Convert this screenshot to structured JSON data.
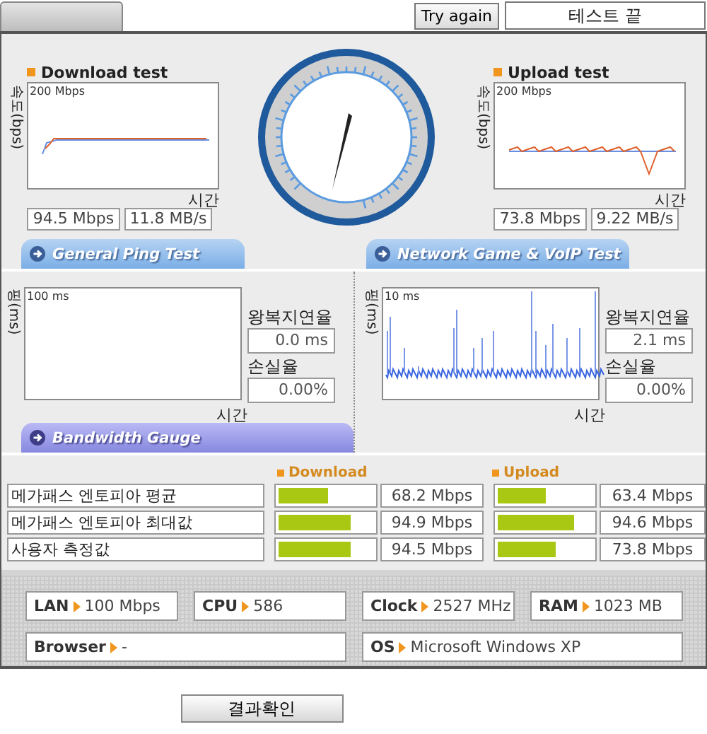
{
  "top_bar": {
    "button": "Try again",
    "status": "테스트 끝"
  },
  "speed_tests": [
    {
      "title": "Download test",
      "ylabel": "속도(bps)",
      "scale": "200 Mbps",
      "xlabel": "시간",
      "readings": [
        "94.5 Mbps",
        "11.8 MB/s"
      ]
    },
    {
      "title": "Upload test",
      "ylabel": "속도(bps)",
      "scale": "200 Mbps",
      "xlabel": "시간",
      "readings": [
        "73.8 Mbps",
        "9.22 MB/s"
      ]
    }
  ],
  "section_tabs": [
    "General Ping Test",
    "Network Game & VoIP Test"
  ],
  "ping_tests": [
    {
      "ylabel": "핑(ms)",
      "scale": "100 ms",
      "xlabel": "시간",
      "has_trace": false,
      "latency_label": "왕복지연율",
      "latency": "0.0 ms",
      "loss_label": "손실율",
      "loss": "0.00%"
    },
    {
      "ylabel": "핑(ms)",
      "scale": "10 ms",
      "xlabel": "시간",
      "has_trace": true,
      "latency_label": "왕복지연율",
      "latency": "2.1 ms",
      "loss_label": "손실율",
      "loss": "0.00%"
    }
  ],
  "bandwidth_tab": "Bandwidth Gauge",
  "comparison": {
    "columns": [
      "Download",
      "Upload"
    ],
    "rows": [
      {
        "label": "메가패스 엔토피아 평균",
        "download": {
          "level": 0.55,
          "reading": "68.2 Mbps"
        },
        "upload": {
          "level": 0.54,
          "reading": "63.4 Mbps"
        }
      },
      {
        "label": "메가패스 엔토피아 최대값",
        "download": {
          "level": 0.78,
          "reading": "94.9 Mbps"
        },
        "upload": {
          "level": 0.82,
          "reading": "94.6 Mbps"
        }
      },
      {
        "label": "사용자 측정값",
        "download": {
          "level": 0.77,
          "reading": "94.5 Mbps"
        },
        "upload": {
          "level": 0.63,
          "reading": "73.8 Mbps"
        }
      }
    ]
  },
  "system_info": [
    {
      "label": "LAN",
      "value": "100 Mbps"
    },
    {
      "label": "CPU",
      "value": "586"
    },
    {
      "label": "Clock",
      "value": "2527 MHz"
    },
    {
      "label": "RAM",
      "value": "1023 MB"
    },
    {
      "label": "Browser",
      "value": "-"
    },
    {
      "label": "OS",
      "value": "Microsoft Windows XP"
    }
  ],
  "result_button": "결과확인"
}
